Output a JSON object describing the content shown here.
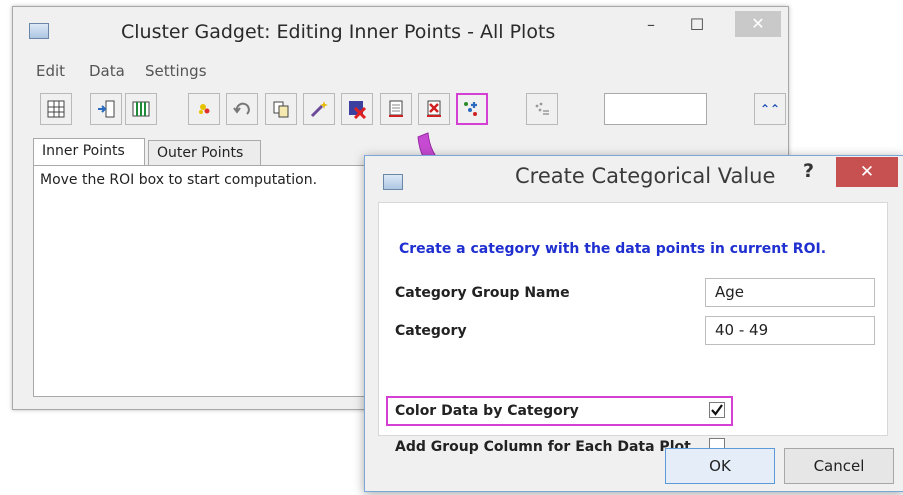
{
  "background_window": {
    "title": "Cluster Gadget: Editing Inner Points - All Plots",
    "controls": {
      "minimize": "–",
      "maximize": "☐",
      "close": "✕"
    },
    "menu": [
      "Edit",
      "Data",
      "Settings"
    ],
    "toolbar_icons": [
      "roi-grid-icon",
      "import-column-icon",
      "columns-icon",
      "select-points-icon",
      "undo-icon",
      "copy-icon",
      "wand-icon",
      "delete-data-icon",
      "mask-icon",
      "mask-red-icon",
      "categorize-icon",
      "dotted-points-icon"
    ],
    "tabs": [
      "Inner Points",
      "Outer Points"
    ],
    "message": "Move the ROI box to start computation.",
    "collapse_symbol": "⌃⌃"
  },
  "dialog": {
    "title": "Create Categorical Value",
    "help": "?",
    "close": "✕",
    "heading": "Create a category with the data points in current ROI.",
    "fields": {
      "group_name_label": "Category Group Name",
      "group_name_value": "Age",
      "category_label": "Category",
      "category_value": "40 - 49",
      "color_label": "Color Data by Category",
      "color_checked": true,
      "add_column_label": "Add Group Column for Each Data Plot",
      "add_column_checked": false
    },
    "ok_label": "OK",
    "cancel_label": "Cancel"
  },
  "colors": {
    "highlight": "#d43fd4",
    "arrow": "#c64bd2",
    "heading": "#1f2fd0",
    "close_red": "#c75050"
  }
}
